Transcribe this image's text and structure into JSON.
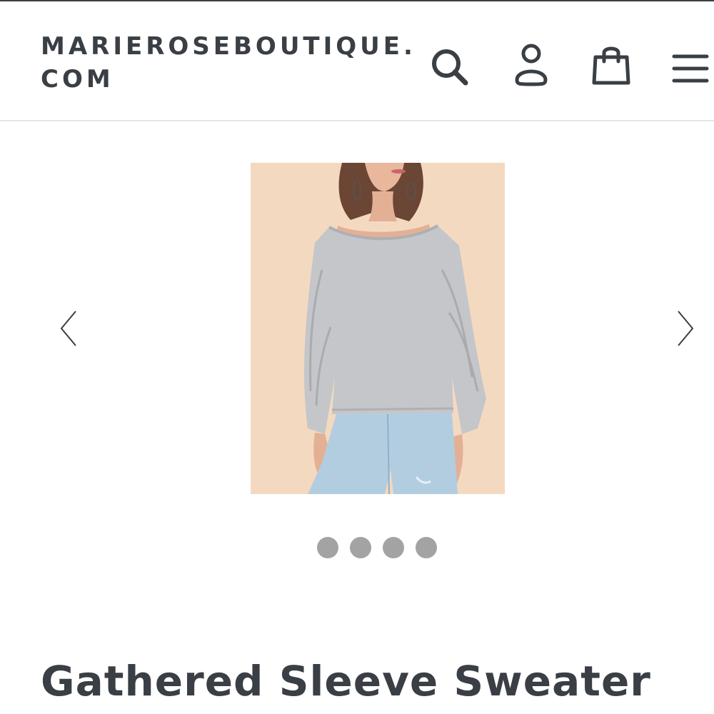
{
  "header": {
    "logo_line1": "MARIEROSEBOUTIQUE.",
    "logo_line2": "COM",
    "icons": [
      "search-icon",
      "account-icon",
      "shopping-bag-icon",
      "hamburger-menu-icon"
    ]
  },
  "gallery": {
    "image_description": "woman wearing gray gathered sleeve sweater and light blue jeans",
    "slide_count": 4,
    "prev_icon": "chevron-left-icon",
    "next_icon": "chevron-right-icon"
  },
  "product": {
    "title": "Gathered Sleeve Sweater"
  },
  "colors": {
    "text": "#3a3f45",
    "dot": "#a3a3a3",
    "image_background": "#f4d9c1",
    "sweater": "#c4c6c9",
    "jeans": "#b3cde0"
  }
}
